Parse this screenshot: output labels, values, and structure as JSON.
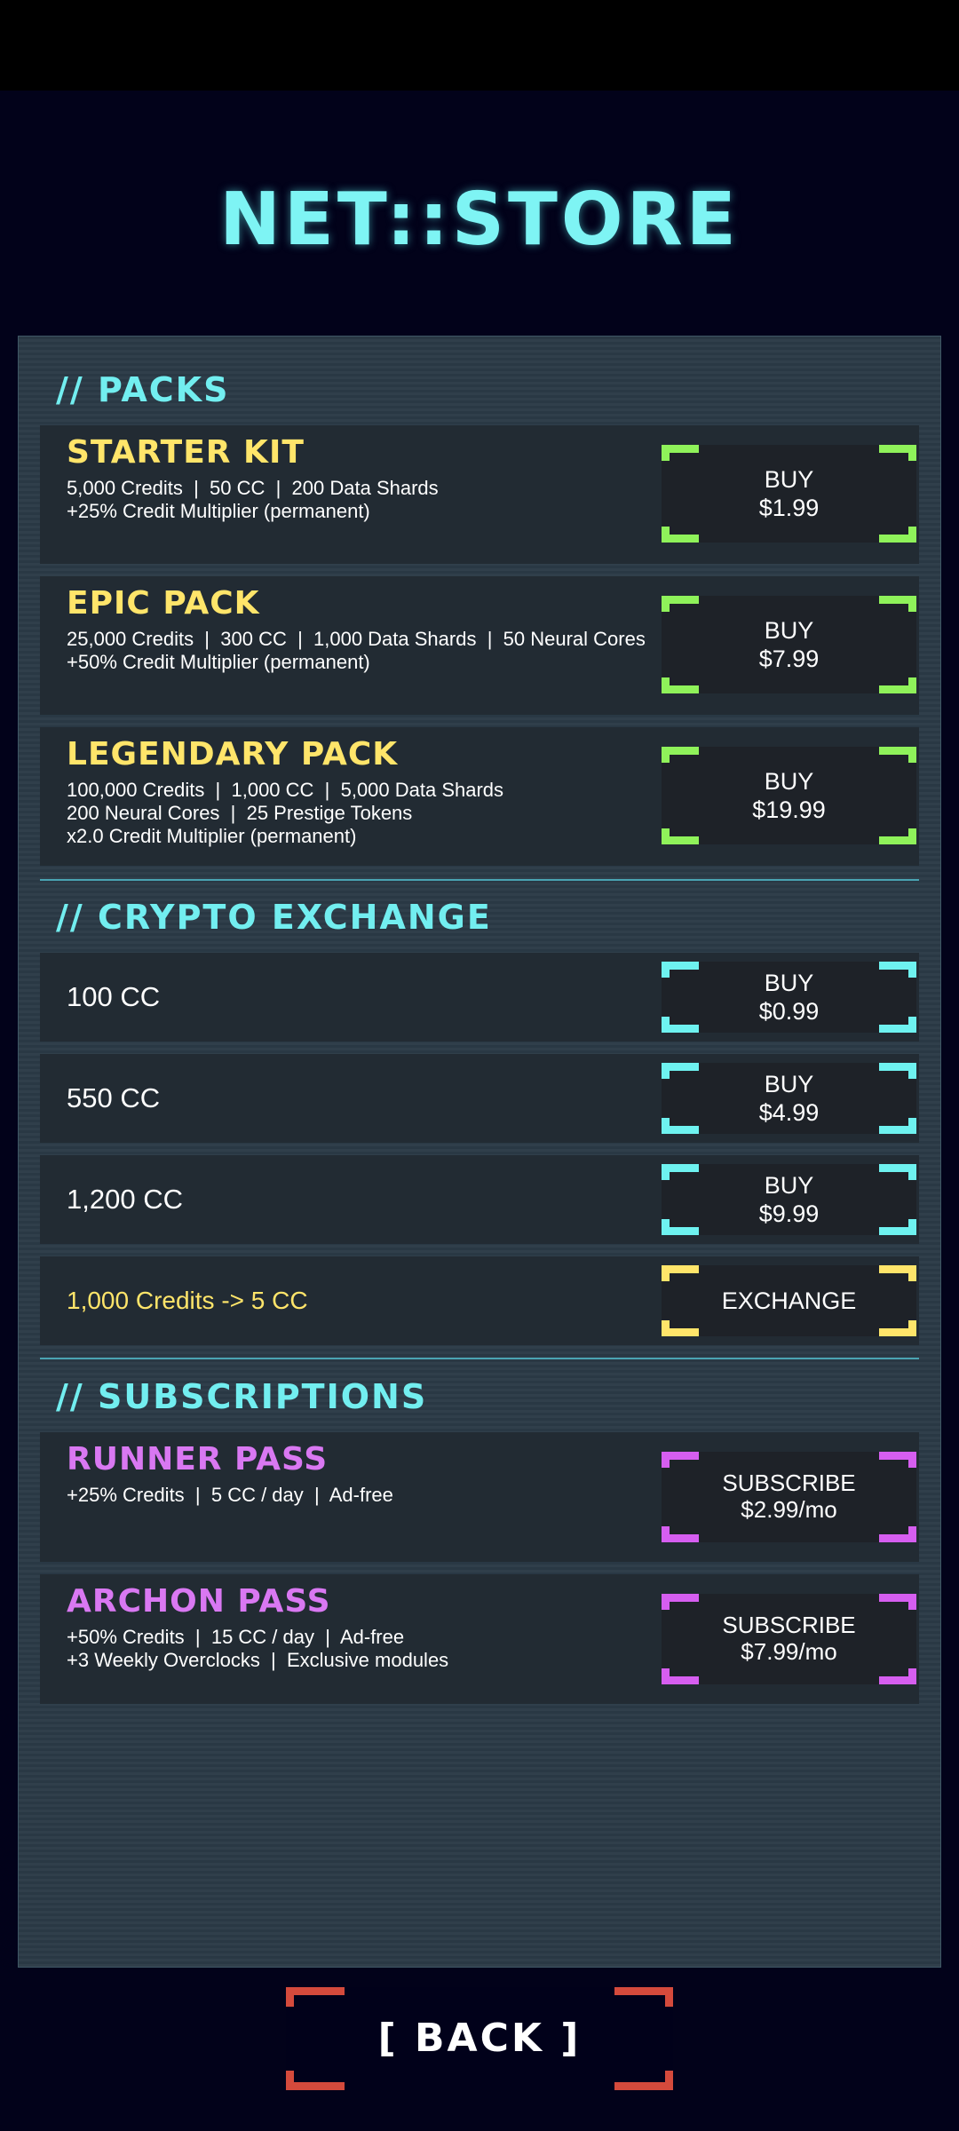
{
  "title": "NET::STORE",
  "colors": {
    "background": "#02021a",
    "panel": "#2a3a46",
    "card": "#222b33",
    "title_cyan": "#7ef4f4",
    "pack_name_yellow": "#ffe56a",
    "sub_name_magenta": "#d978f2",
    "green_bracket": "#8ff25a",
    "cyan_bracket": "#6ef2f0",
    "yellow_bracket": "#ffe56a",
    "magenta_bracket": "#d65ef0",
    "red_bracket": "#d44a3c"
  },
  "packs": {
    "title": "// PACKS",
    "items": [
      {
        "name": "STARTER KIT",
        "desc": "5,000 Credits  |  50 CC  |  200 Data Shards\n+25% Credit Multiplier (permanent)",
        "action": "BUY",
        "price": "$1.99"
      },
      {
        "name": "EPIC PACK",
        "desc": "25,000 Credits  |  300 CC  |  1,000 Data Shards  |  50 Neural Cores\n+50% Credit Multiplier (permanent)",
        "action": "BUY",
        "price": "$7.99"
      },
      {
        "name": "LEGENDARY PACK",
        "desc": "100,000 Credits  |  1,000 CC  |  5,000 Data Shards\n200 Neural Cores  |  25 Prestige Tokens\nx2.0 Credit Multiplier (permanent)",
        "action": "BUY",
        "price": "$19.99"
      }
    ]
  },
  "crypto": {
    "title": "// CRYPTO EXCHANGE",
    "items": [
      {
        "amount": "100 CC",
        "action": "BUY",
        "price": "$0.99"
      },
      {
        "amount": "550 CC",
        "action": "BUY",
        "price": "$4.99"
      },
      {
        "amount": "1,200 CC",
        "action": "BUY",
        "price": "$9.99"
      }
    ],
    "exchange": {
      "text": "1,000 Credits  ->  5 CC",
      "action": "EXCHANGE"
    }
  },
  "subscriptions": {
    "title": "// SUBSCRIPTIONS",
    "items": [
      {
        "name": "RUNNER PASS",
        "desc": "+25% Credits  |  5 CC / day  |  Ad-free",
        "action": "SUBSCRIBE",
        "price": "$2.99/mo"
      },
      {
        "name": "ARCHON PASS",
        "desc": "+50% Credits  |  15 CC / day  |  Ad-free\n+3 Weekly Overclocks  |  Exclusive modules",
        "action": "SUBSCRIBE",
        "price": "$7.99/mo"
      }
    ]
  },
  "back": "[ BACK ]"
}
